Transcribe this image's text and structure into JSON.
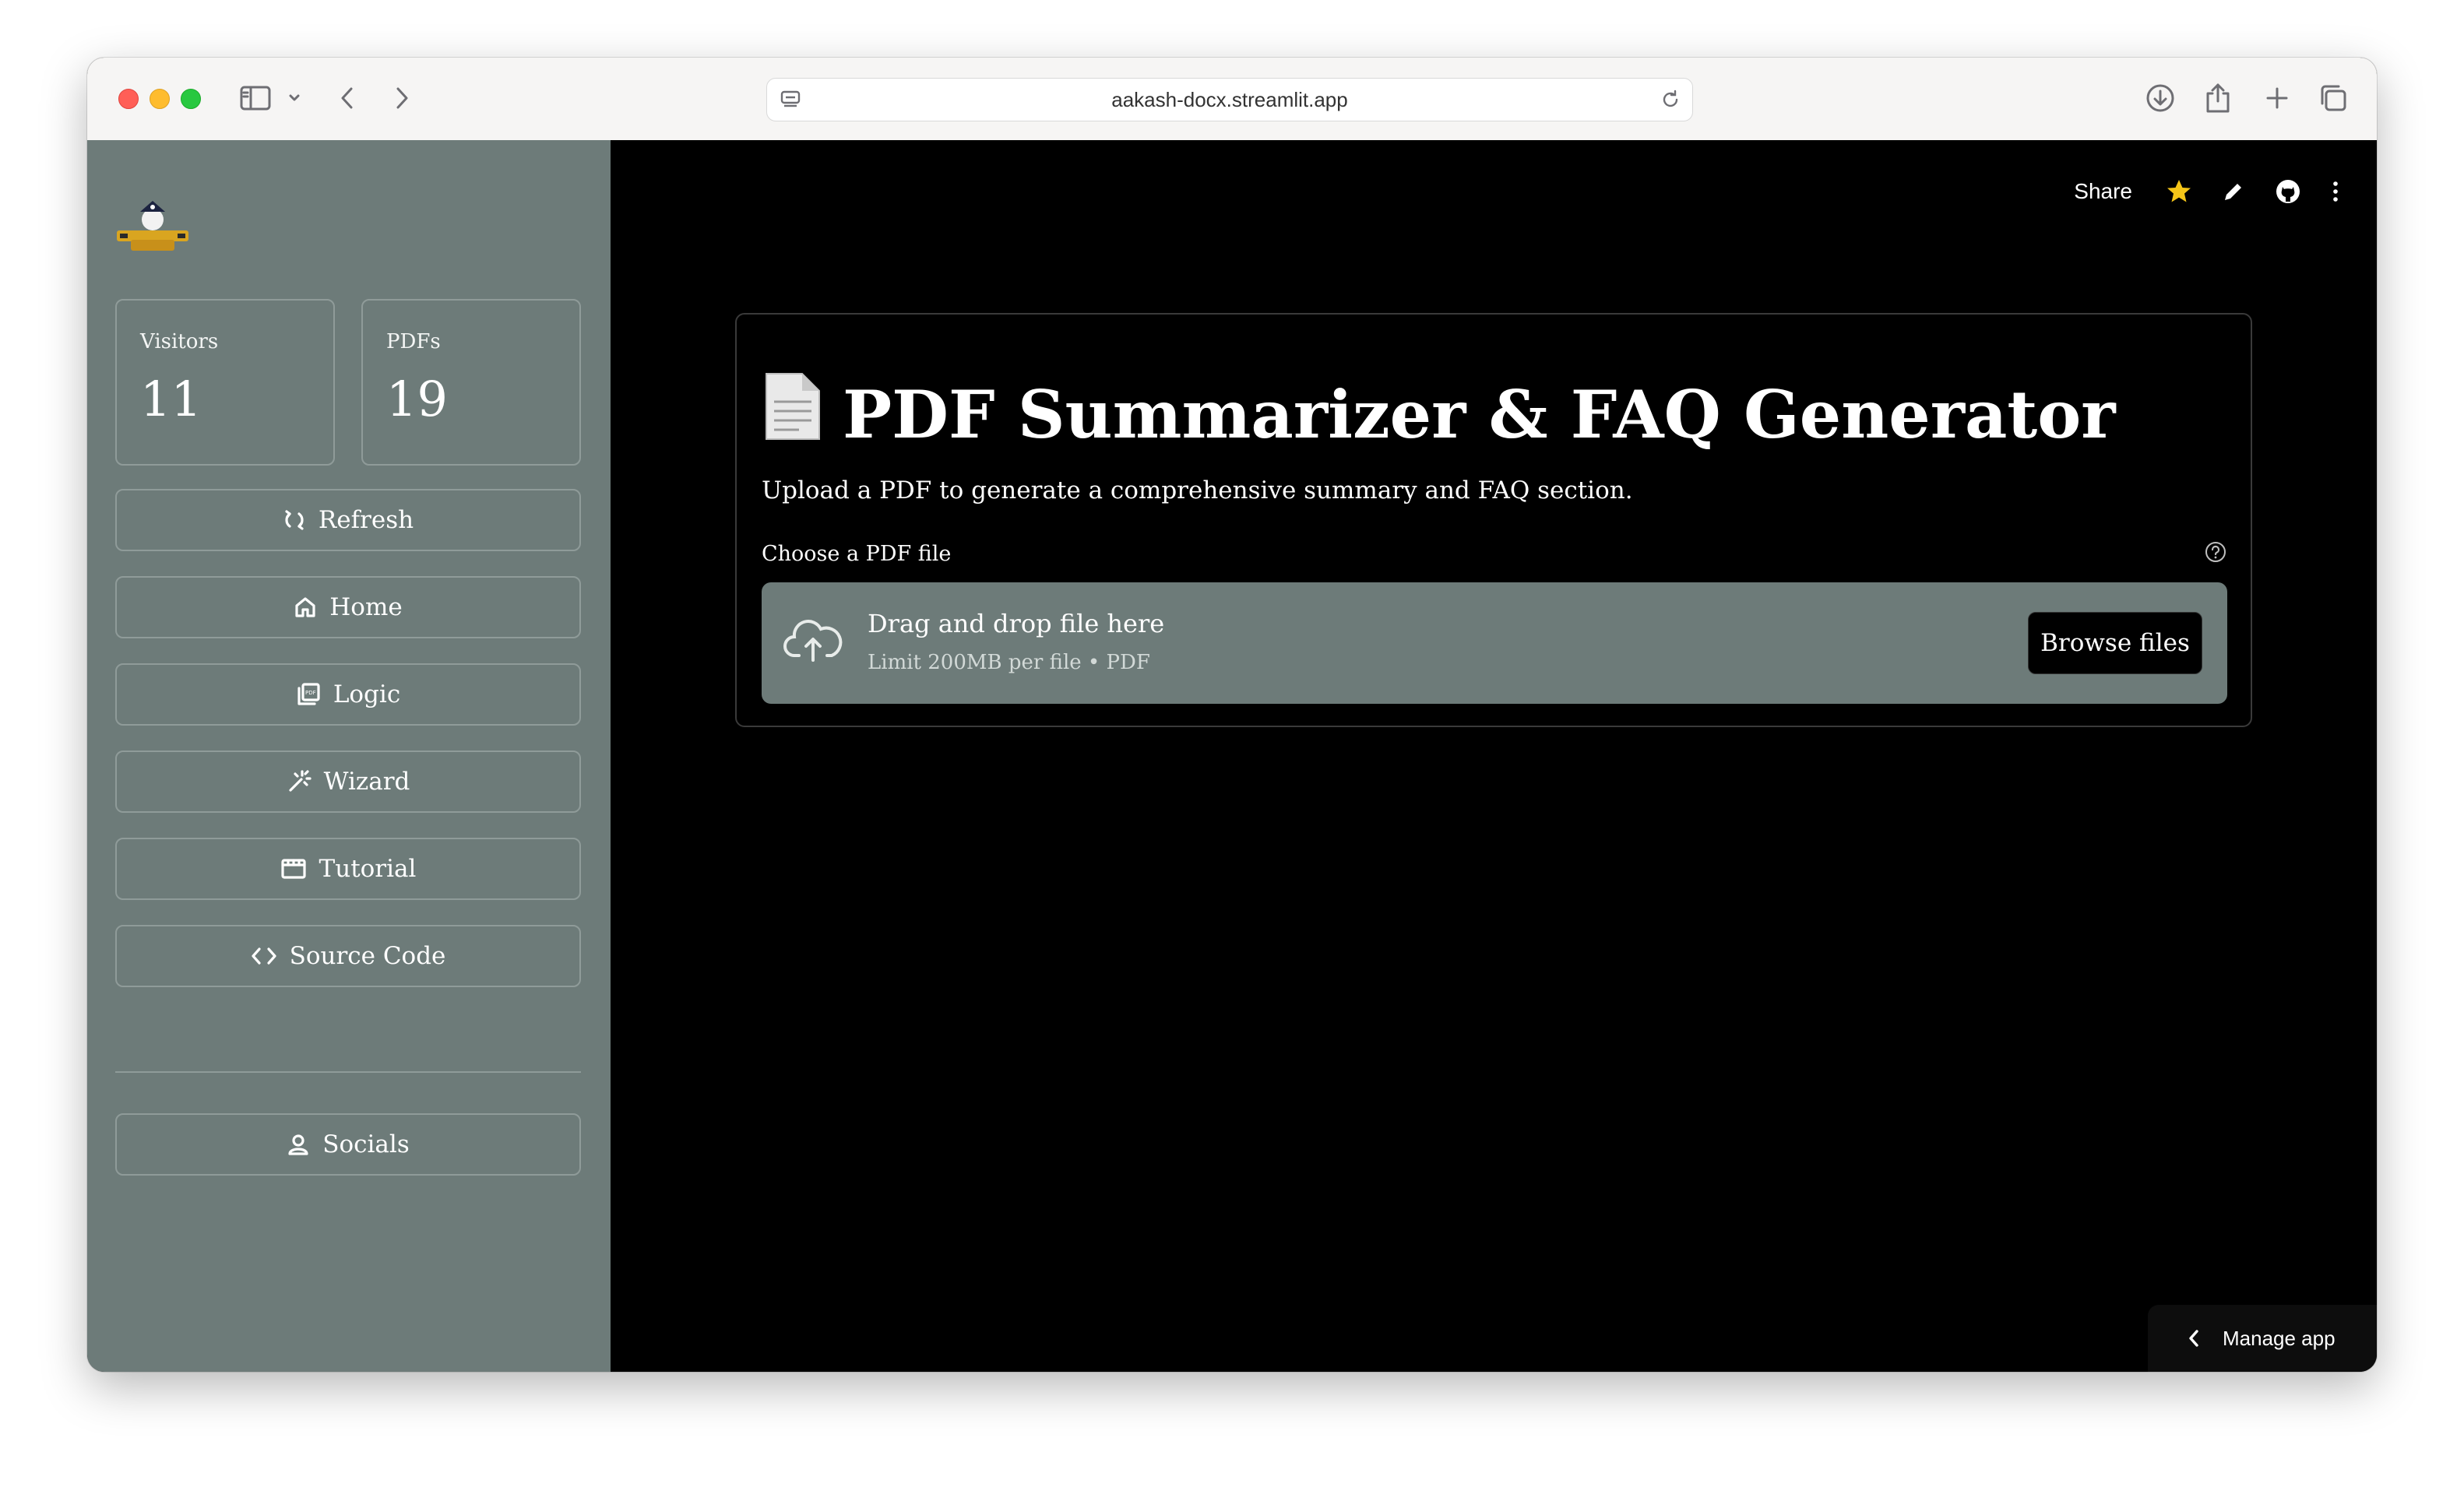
{
  "browser": {
    "url": "aakash-docx.streamlit.app"
  },
  "sidebar": {
    "metrics": [
      {
        "label": "Visitors",
        "value": "11"
      },
      {
        "label": "PDFs",
        "value": "19"
      }
    ],
    "buttons": [
      {
        "label": "Refresh",
        "icon": "refresh-icon"
      },
      {
        "label": "Home",
        "icon": "home-icon"
      },
      {
        "label": "Logic",
        "icon": "pdf-icon"
      },
      {
        "label": "Wizard",
        "icon": "wand-icon"
      },
      {
        "label": "Tutorial",
        "icon": "video-icon"
      },
      {
        "label": "Source Code",
        "icon": "code-icon"
      }
    ],
    "socials_label": "Socials"
  },
  "topbar": {
    "share_label": "Share",
    "star_color": "#f5c518"
  },
  "main": {
    "title_icon": "📄",
    "title": "PDF Summarizer & FAQ Generator",
    "subtitle": "Upload a PDF to generate a comprehensive summary and FAQ section.",
    "uploader": {
      "label": "Choose a PDF file",
      "drop_text": "Drag and drop file here",
      "limit_text": "Limit 200MB per file • PDF",
      "browse_label": "Browse files"
    }
  },
  "manage_app_label": "Manage app",
  "colors": {
    "sidebar_bg": "#6d7b79",
    "main_bg": "#000000",
    "dropzone_bg": "#6d7b79"
  }
}
